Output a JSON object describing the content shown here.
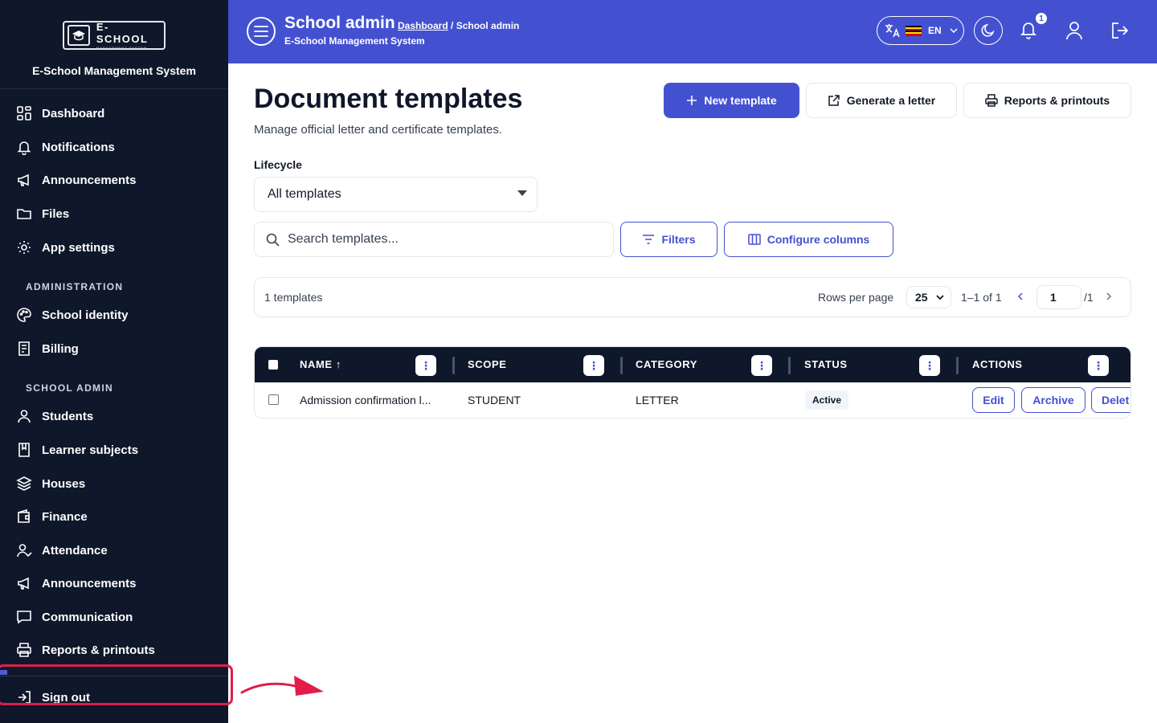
{
  "brand": {
    "logo_text": "E-SCHOOL",
    "logo_tagline": "MANAGEMENT SYSTEM",
    "system_name": "E-School Management System"
  },
  "sidebar": {
    "items_top": [
      {
        "label": "Dashboard",
        "icon": "dashboard-icon"
      },
      {
        "label": "Notifications",
        "icon": "bell-icon"
      },
      {
        "label": "Announcements",
        "icon": "megaphone-icon"
      },
      {
        "label": "Files",
        "icon": "folder-icon"
      },
      {
        "label": "App settings",
        "icon": "gear-icon"
      }
    ],
    "section_admin": "ADMINISTRATION",
    "items_admin": [
      {
        "label": "School identity",
        "icon": "palette-icon"
      },
      {
        "label": "Billing",
        "icon": "invoice-icon"
      }
    ],
    "section_school": "SCHOOL ADMIN",
    "items_school": [
      {
        "label": "Students",
        "icon": "user-icon"
      },
      {
        "label": "Learner subjects",
        "icon": "book-icon"
      },
      {
        "label": "Houses",
        "icon": "layers-icon"
      },
      {
        "label": "Finance",
        "icon": "wallet-icon"
      },
      {
        "label": "Attendance",
        "icon": "user-check-icon"
      },
      {
        "label": "Announcements",
        "icon": "megaphone-icon"
      },
      {
        "label": "Communication",
        "icon": "chat-icon"
      },
      {
        "label": "Reports & printouts",
        "icon": "printer-icon"
      }
    ],
    "progress": 0.03,
    "sign_out": "Sign out"
  },
  "header": {
    "title": "School admin",
    "breadcrumb_link": "Dashboard",
    "breadcrumb_current": "/ School admin",
    "subtitle": "E-School Management System",
    "language": "EN",
    "notification_count": "1"
  },
  "main": {
    "title": "Document templates",
    "subtitle": "Manage official letter and certificate templates.",
    "new_template": "New template",
    "generate_letter": "Generate a letter",
    "reports": "Reports & printouts",
    "lifecycle_label": "Lifecycle",
    "lifecycle_value": "All templates",
    "search_placeholder": "Search templates...",
    "filters": "Filters",
    "configure_columns": "Configure columns"
  },
  "pager": {
    "count": "1 templates",
    "rows_per_page_label": "Rows per page",
    "rows_per_page": "25",
    "range": "1–1 of 1",
    "page": "1",
    "total_pages": "/1"
  },
  "table": {
    "columns": [
      "NAME ↑",
      "SCOPE",
      "CATEGORY",
      "STATUS",
      "ACTIONS"
    ],
    "rows": [
      {
        "name": "Admission confirmation l...",
        "scope": "STUDENT",
        "category": "LETTER",
        "status": "Active"
      }
    ],
    "actions": [
      "Edit",
      "Archive",
      "Delet"
    ]
  },
  "colors": {
    "sidebar": "#0f172a",
    "accent": "#4351d1",
    "annotation": "#e11d48"
  }
}
